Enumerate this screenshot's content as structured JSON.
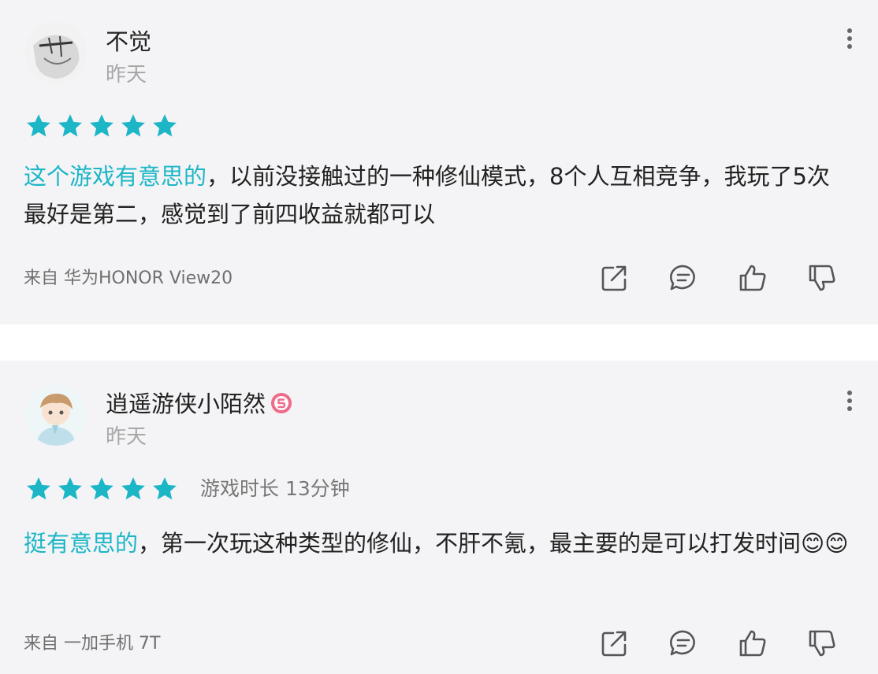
{
  "reviews": [
    {
      "username": "不觉",
      "date": "昨天",
      "rating": 5,
      "playtime": "",
      "content_highlight": "这个游戏有意思的",
      "content_rest": "，以前没接触过的一种修仙模式，8个人互相竞争，我玩了5次最好是第二，感觉到了前四收益就都可以",
      "source": "来自 华为HONOR View20",
      "actions": [
        "share-icon",
        "comment-icon",
        "thumbs-up-icon",
        "thumbs-down-icon"
      ]
    },
    {
      "username": "逍遥游侠小陌然",
      "date": "昨天",
      "rating": 5,
      "playtime": "游戏时长 13分钟",
      "content_highlight": "挺有意思的",
      "content_rest": "，第一次玩这种类型的修仙，不肝不氪，最主要的是可以打发时间😊😊",
      "source": "来自 一加手机 7T",
      "actions": [
        "share-icon",
        "comment-icon",
        "thumbs-up-icon",
        "thumbs-down-icon"
      ]
    }
  ],
  "colors": {
    "star": "#1cb6c6",
    "highlight": "#1cb6c6",
    "card_bg": "#f4f4f6",
    "icon": "#555555",
    "badge": "#f06a8a"
  }
}
